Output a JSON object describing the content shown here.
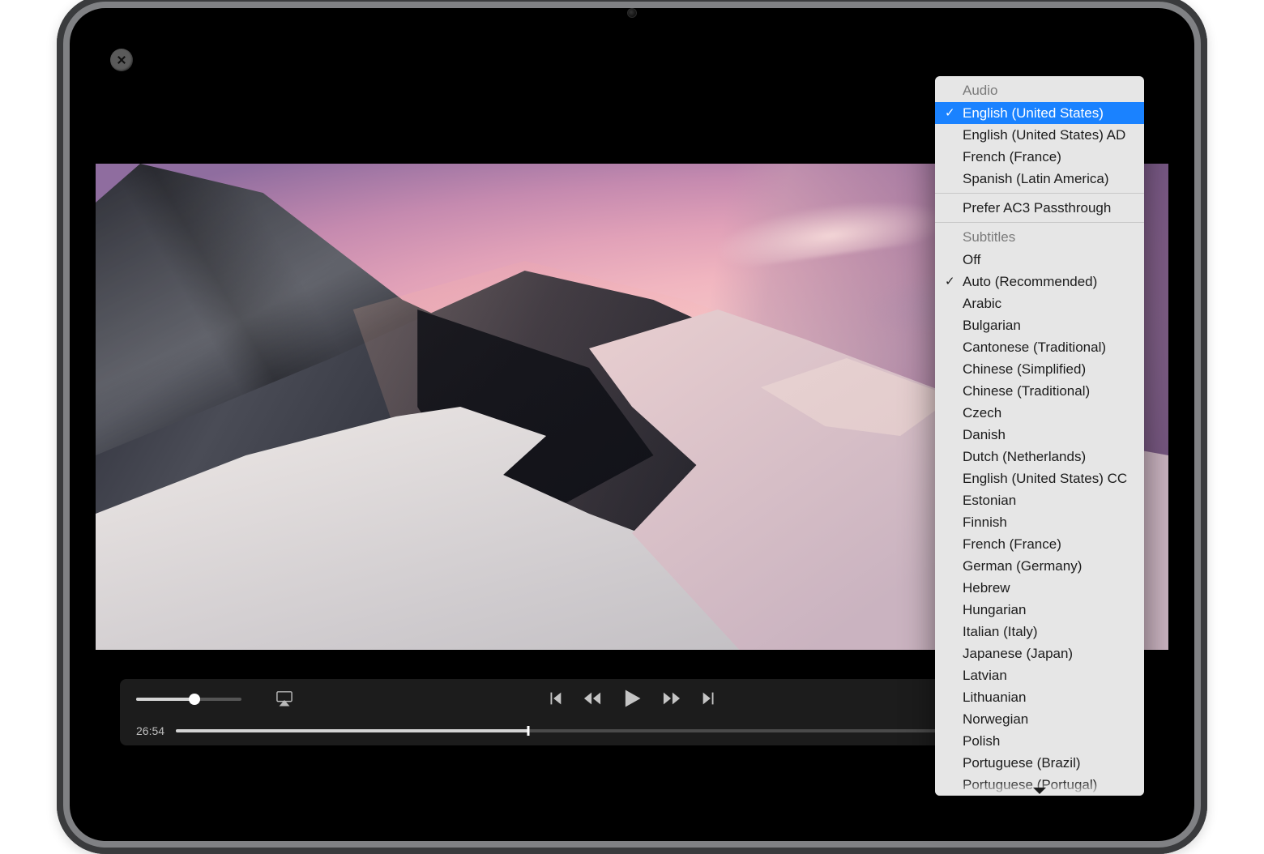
{
  "player": {
    "elapsed": "26:54",
    "volume_pct": 55,
    "scrub_pct": 37
  },
  "menu": {
    "audio_header": "Audio",
    "audio": [
      {
        "label": "English (United States)",
        "selected": true
      },
      {
        "label": "English (United States) AD"
      },
      {
        "label": "French (France)"
      },
      {
        "label": "Spanish (Latin America)"
      }
    ],
    "ac3_option": "Prefer AC3 Passthrough",
    "subtitles_header": "Subtitles",
    "subtitles": [
      {
        "label": "Off"
      },
      {
        "label": "Auto (Recommended)",
        "checked": true
      },
      {
        "label": "Arabic"
      },
      {
        "label": "Bulgarian"
      },
      {
        "label": "Cantonese (Traditional)"
      },
      {
        "label": "Chinese (Simplified)"
      },
      {
        "label": "Chinese (Traditional)"
      },
      {
        "label": "Czech"
      },
      {
        "label": "Danish"
      },
      {
        "label": "Dutch (Netherlands)"
      },
      {
        "label": "English (United States) CC"
      },
      {
        "label": "Estonian"
      },
      {
        "label": "Finnish"
      },
      {
        "label": "French (France)"
      },
      {
        "label": "German (Germany)"
      },
      {
        "label": "Hebrew"
      },
      {
        "label": "Hungarian"
      },
      {
        "label": "Italian (Italy)"
      },
      {
        "label": "Japanese (Japan)"
      },
      {
        "label": "Latvian"
      },
      {
        "label": "Lithuanian"
      },
      {
        "label": "Norwegian"
      },
      {
        "label": "Polish"
      },
      {
        "label": "Portuguese (Brazil)"
      },
      {
        "label": "Portuguese (Portugal)"
      }
    ]
  }
}
